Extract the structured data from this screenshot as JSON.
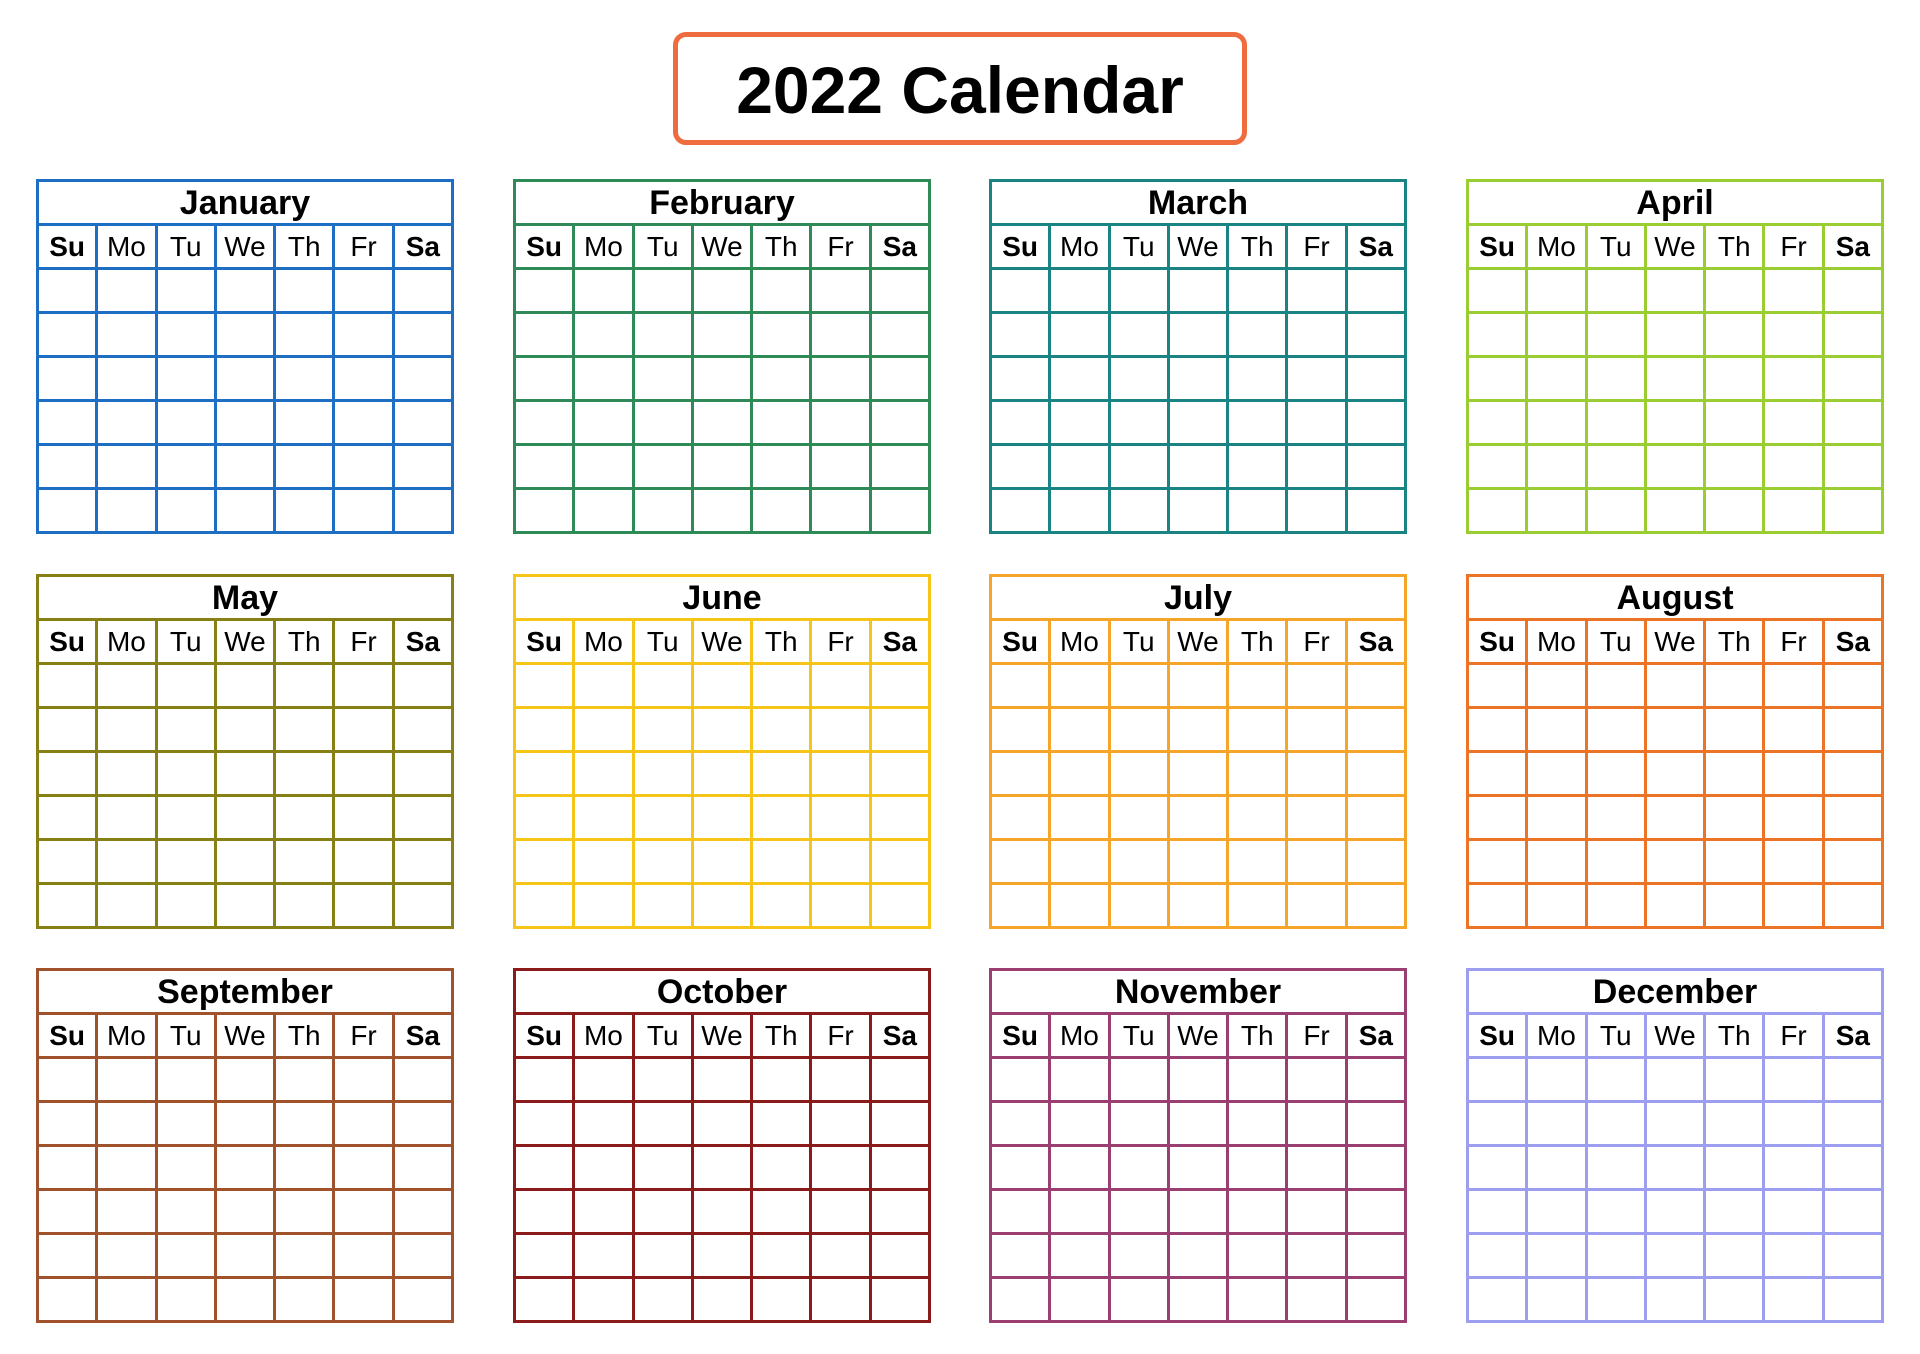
{
  "title": "2022 Calendar",
  "title_border_color": "#ef6c3e",
  "weekdays": [
    {
      "label": "Su",
      "bold": true
    },
    {
      "label": "Mo",
      "bold": false
    },
    {
      "label": "Tu",
      "bold": false
    },
    {
      "label": "We",
      "bold": false
    },
    {
      "label": "Th",
      "bold": false
    },
    {
      "label": "Fr",
      "bold": false
    },
    {
      "label": "Sa",
      "bold": true
    }
  ],
  "weeks_per_month": 6,
  "months": [
    {
      "name": "January",
      "color": "#1e6fc4"
    },
    {
      "name": "February",
      "color": "#2e8b57"
    },
    {
      "name": "March",
      "color": "#1a8384"
    },
    {
      "name": "April",
      "color": "#9acd32"
    },
    {
      "name": "May",
      "color": "#878015"
    },
    {
      "name": "June",
      "color": "#f5c518"
    },
    {
      "name": "July",
      "color": "#f5a52a"
    },
    {
      "name": "August",
      "color": "#ec7426"
    },
    {
      "name": "September",
      "color": "#a0522d"
    },
    {
      "name": "October",
      "color": "#8b1a1a"
    },
    {
      "name": "November",
      "color": "#9b3f72"
    },
    {
      "name": "December",
      "color": "#9d9ef0"
    }
  ]
}
